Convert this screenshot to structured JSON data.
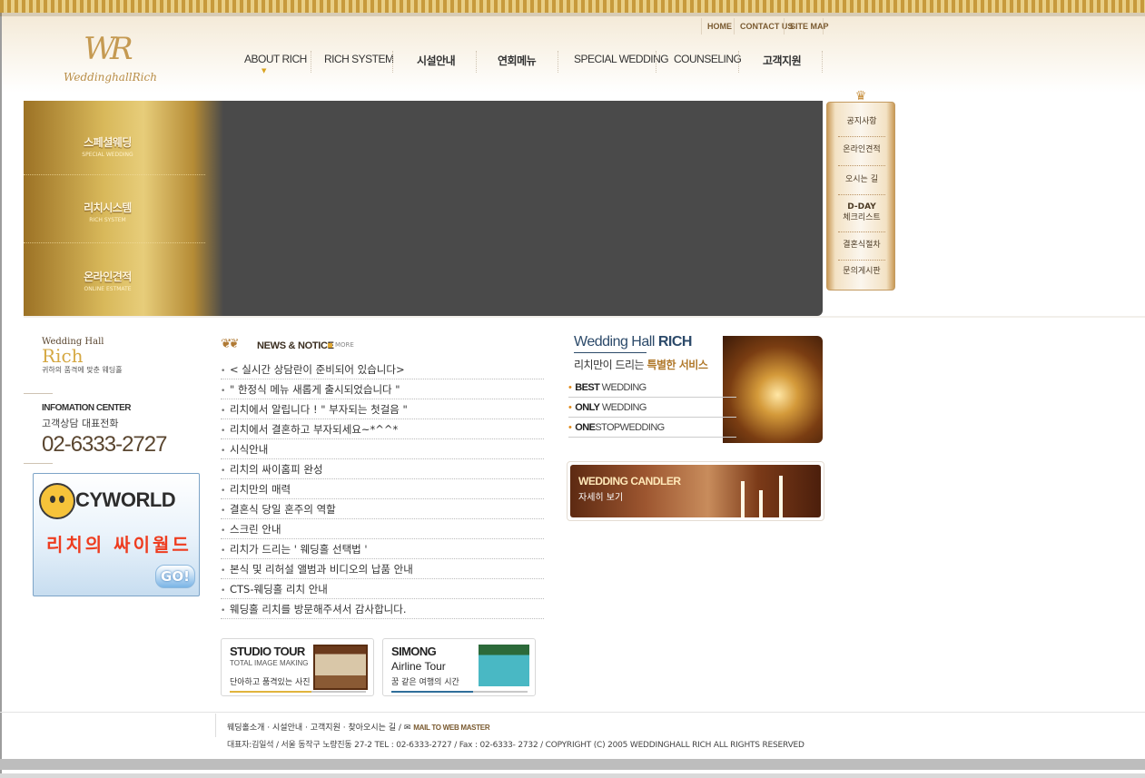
{
  "site": {
    "logo_name": "WeddinghallRich",
    "logo_monogram": "WR"
  },
  "util_nav": [
    "HOME",
    "CONTACT US",
    "SITE MAP"
  ],
  "gnb": [
    "ABOUT RICH",
    "RICH SYSTEM",
    "시설안내",
    "연회메뉴",
    "SPECIAL WEDDING",
    "COUNSELING",
    "고객지원"
  ],
  "visual_menu": [
    {
      "ko": "스페셜웨딩",
      "en": "SPECIAL WEDDING"
    },
    {
      "ko": "리치시스템",
      "en": "RICH SYSTEM"
    },
    {
      "ko": "온라인견적",
      "en": "ONLINE ESTMATE"
    }
  ],
  "quick_menu": [
    {
      "label": "공지사항"
    },
    {
      "label": "온라인견적"
    },
    {
      "label": "오시는 길"
    },
    {
      "label": "D-DAY",
      "label2": "체크리스트"
    },
    {
      "label": "결혼식절차"
    },
    {
      "label": "문의게시판"
    }
  ],
  "left": {
    "brand_small": "Wedding Hall",
    "brand_big": "Rich",
    "brand_sub": "귀하의 품격에 맞춘 웨딩홀",
    "info_title": "INFOMATION CENTER",
    "info_sub": "고객상담 대표전화",
    "info_tel": "02-6333-2727"
  },
  "cyworld": {
    "logo": "CYWORLD",
    "text": "리치의 싸이월드",
    "go": "GO!"
  },
  "news": {
    "title": "NEWS & NOTICE",
    "more": "MORE",
    "items": [
      "< 실시간 상담란이 준비되어 있습니다>",
      "\" 한정식 메뉴 새롭게 출시되었습니다 \"",
      "리치에서 알립니다 ! \" 부자되는 첫걸음 \"",
      "리치에서 결혼하고 부자되세요~*^^*",
      "시식안내",
      "리치의 싸이홈피 완성",
      "리치만의 매력",
      "결혼식 당일 혼주의 역할",
      "스크린 안내",
      "리치가 드리는 ' 웨딩홀 선택법 '",
      "본식 및 리허설 앨범과 비디오의 납품 안내",
      "CTS-웨딩홀 리치 안내",
      "웨딩홀 리치를 방문해주셔서 감사합니다."
    ]
  },
  "promos": [
    {
      "t1": "STUDIO TOUR",
      "t2": "TOTAL IMAGE MAKING",
      "t3": "단아하고 품격있는 사진"
    },
    {
      "t1": "SIMONG",
      "t2": "Airline Tour",
      "t3": "꿈 같은 여행의 시간"
    }
  ],
  "service": {
    "title_a": "Wedding Hall",
    "title_b": "RICH",
    "sub_a": "리치만이 드리는",
    "sub_b": "특별한 서비스",
    "features": [
      {
        "b": "BEST",
        "rest": "WEDDING"
      },
      {
        "b": "ONLY",
        "rest": "WEDDING"
      },
      {
        "b": "ONE",
        "rest": "STOPWEDDING"
      }
    ]
  },
  "candler": {
    "t1": "WEDDING CANDLER",
    "t2": "자세히 보기"
  },
  "footer": {
    "links": [
      "웨딩홀소개",
      "시설안내",
      "고객지원",
      "찾아오시는 길"
    ],
    "mail": "MAIL TO WEB MASTER",
    "info": "대표자:김일석 / 서울 동작구 노량진동 27-2    TEL : 02-6333-2727  /  Fax : 02-6333- 2732   /  COPYRIGHT (C) 2005 WEDDINGHALL RICH  ALL RIGHTS RESERVED"
  },
  "colors": {
    "gold": "#c59a52",
    "visual_dark": "#4a4a4a",
    "accent_orange": "#e0a834"
  }
}
